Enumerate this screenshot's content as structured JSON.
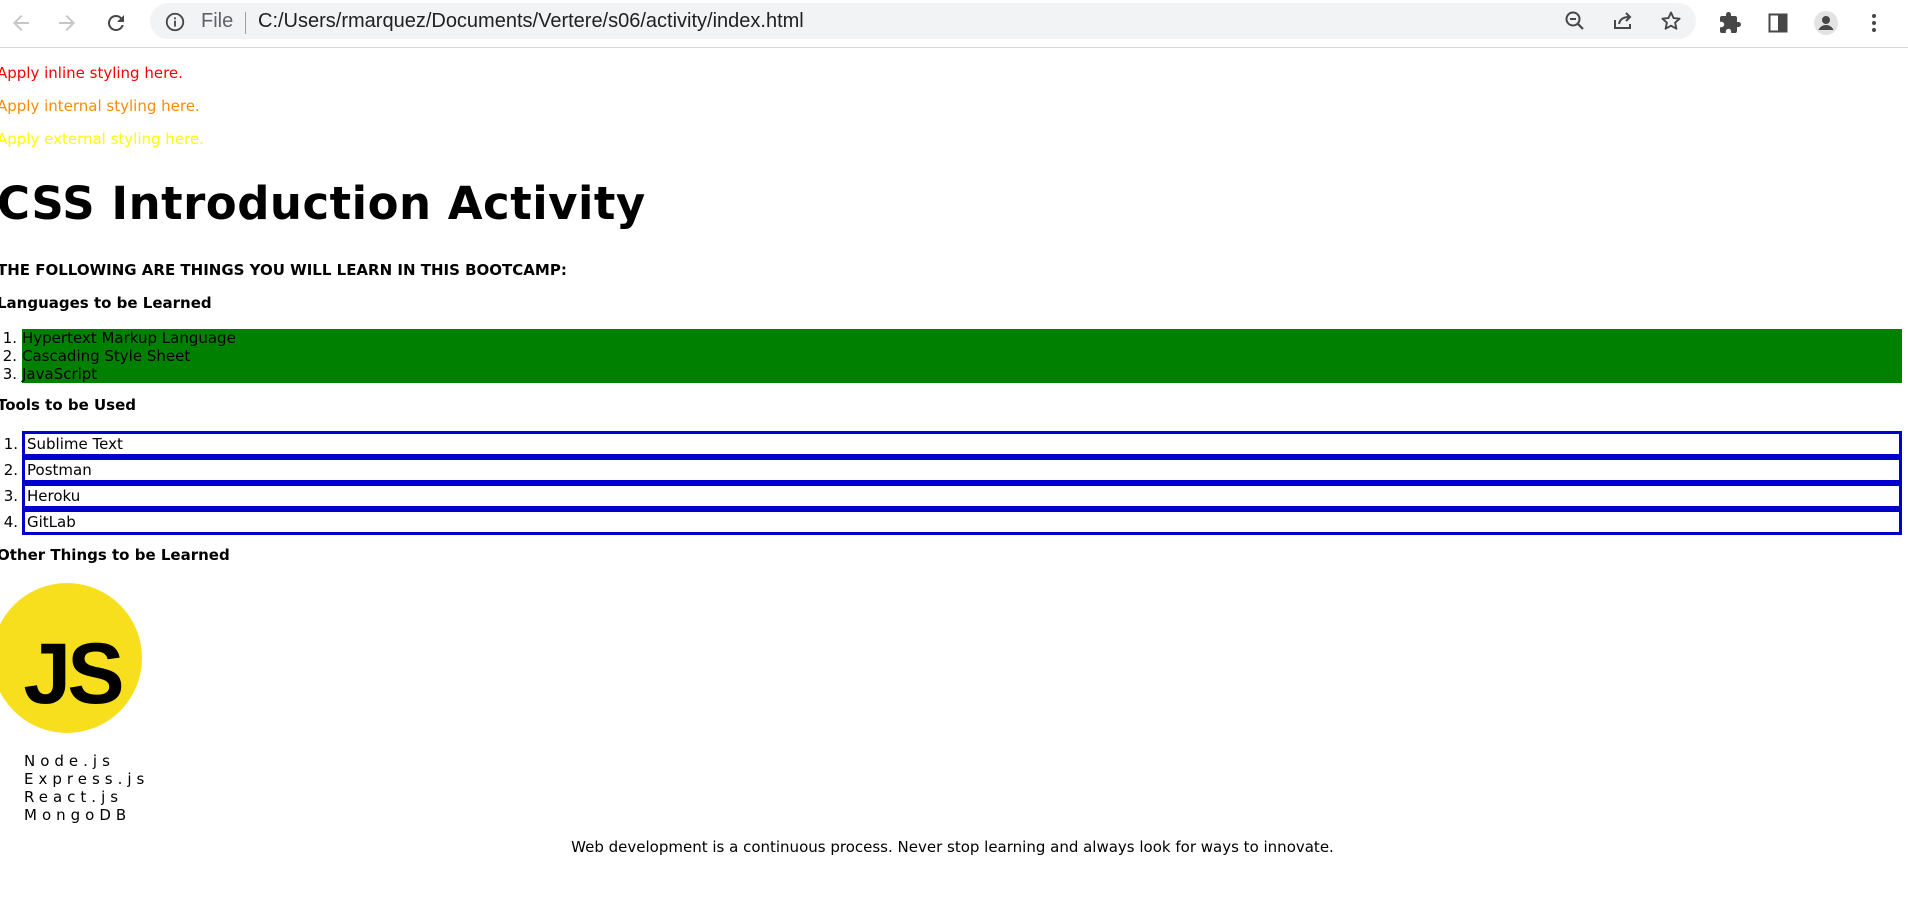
{
  "browser": {
    "omnibox": {
      "scheme_label": "File",
      "url": "C:/Users/rmarquez/Documents/Vertere/s06/activity/index.html"
    },
    "icons": {
      "back": "back-arrow-icon",
      "forward": "forward-arrow-icon",
      "reload": "reload-icon",
      "info": "info-icon",
      "zoom": "zoom-out-icon",
      "share": "share-icon",
      "bookmark": "star-icon",
      "extensions": "puzzle-icon",
      "side_panel": "side-panel-icon",
      "profile": "profile-avatar-icon",
      "menu": "kebab-menu-icon"
    }
  },
  "page": {
    "styling_lines": {
      "inline": "Apply inline styling here.",
      "internal": "Apply internal styling here.",
      "external": "Apply external styling here."
    },
    "title": "CSS Introduction Activity",
    "caps_heading": "THE FOLLOWING ARE THINGS YOU WILL LEARN IN THIS BOOTCAMP:",
    "languages": {
      "heading": "Languages to be Learned",
      "items": [
        "Hypertext Markup Language",
        "Cascading Style Sheet",
        "JavaScript"
      ]
    },
    "tools": {
      "heading": "Tools to be Used",
      "items": [
        "Sublime Text",
        "Postman",
        "Heroku",
        "GitLab"
      ]
    },
    "other": {
      "heading": "Other Things to be Learned",
      "logo_text": "JS",
      "items": [
        "Node.js",
        "Express.js",
        "React.js",
        "MongoDB"
      ]
    },
    "footer": "Web development is a continuous process. Never stop learning and always look for ways to innovate."
  },
  "colors": {
    "inline_text": "#ff0000",
    "internal_text": "#ff8c00",
    "external_text": "#ffff00",
    "languages_bg": "#008000",
    "tools_border": "#0000cd",
    "js_logo_bg": "#f7df1e"
  }
}
